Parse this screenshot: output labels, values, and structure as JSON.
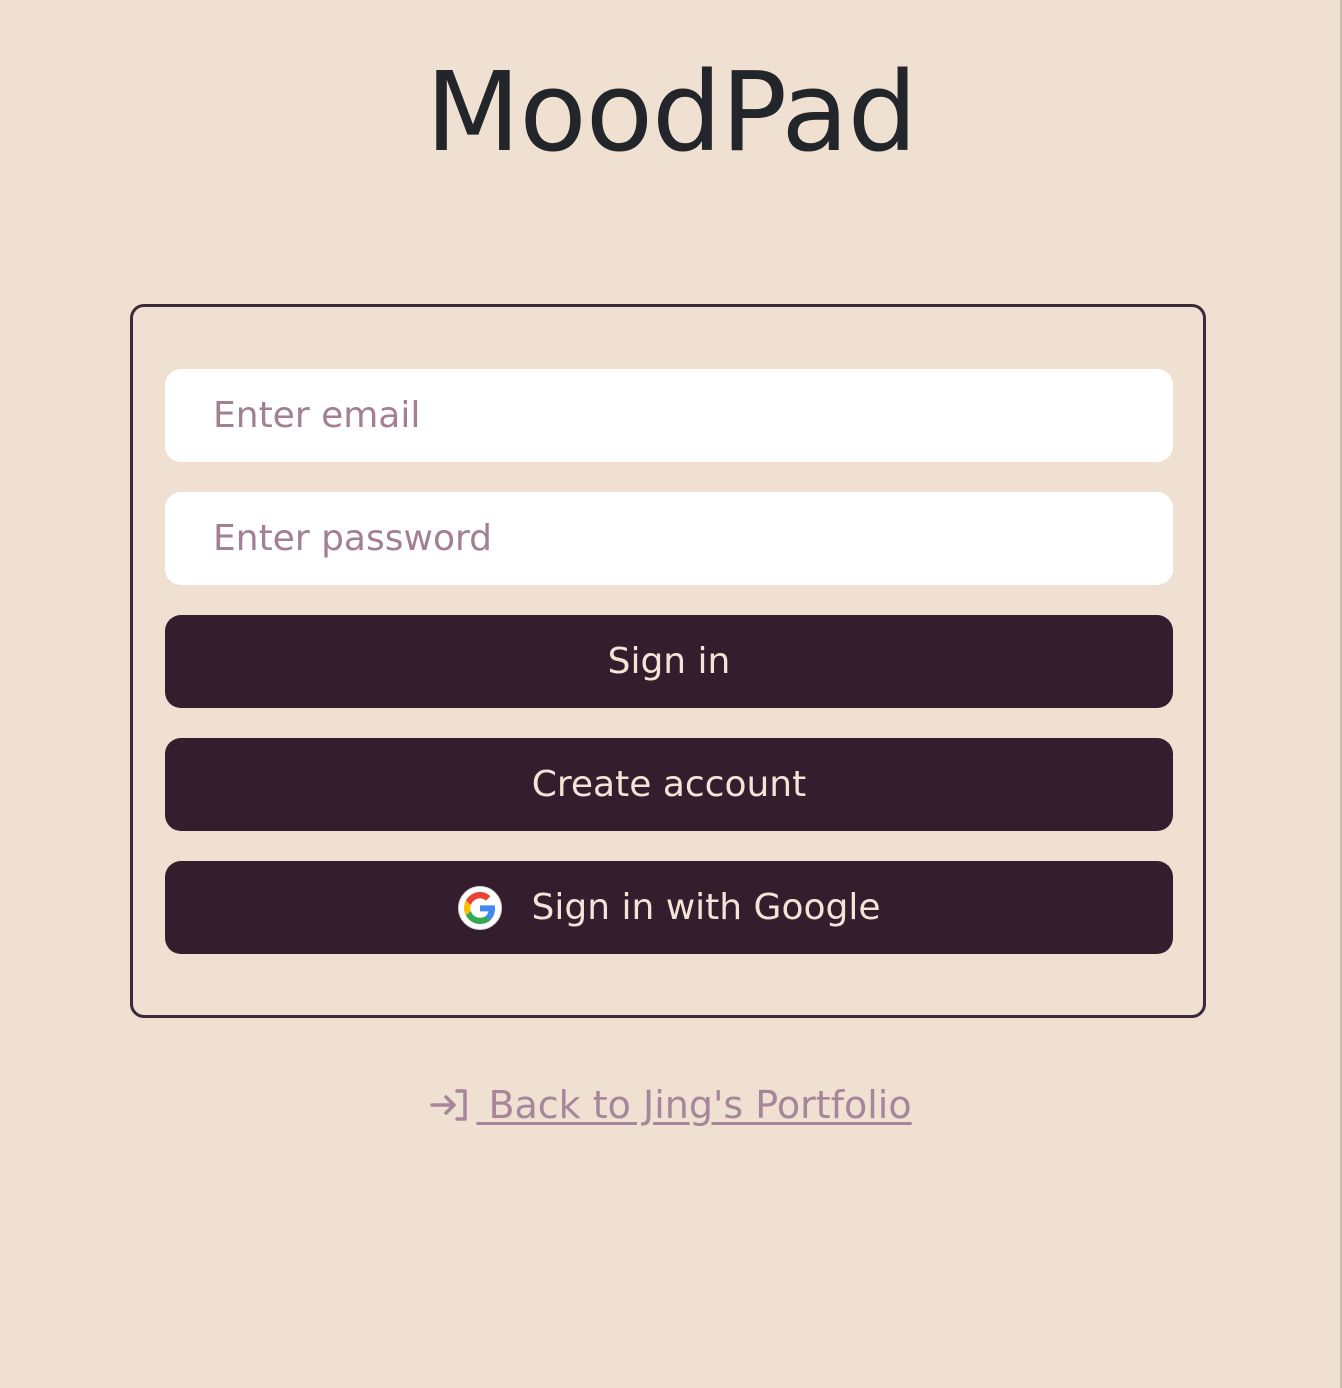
{
  "app": {
    "title": "MoodPad"
  },
  "form": {
    "email_placeholder": "Enter email",
    "password_placeholder": "Enter password",
    "signin_label": "Sign in",
    "create_label": "Create account",
    "google_label": "Sign in with Google"
  },
  "footer": {
    "back_label": " Back to Jing's Portfolio",
    "back_icon": "sign-in-arrow-icon"
  },
  "colors": {
    "background": "#f0e0d2",
    "button": "#341d2d",
    "button_text": "#f3e4d8",
    "placeholder": "#a27f92",
    "link": "#a7859a",
    "card_border": "#3b2a3a"
  }
}
